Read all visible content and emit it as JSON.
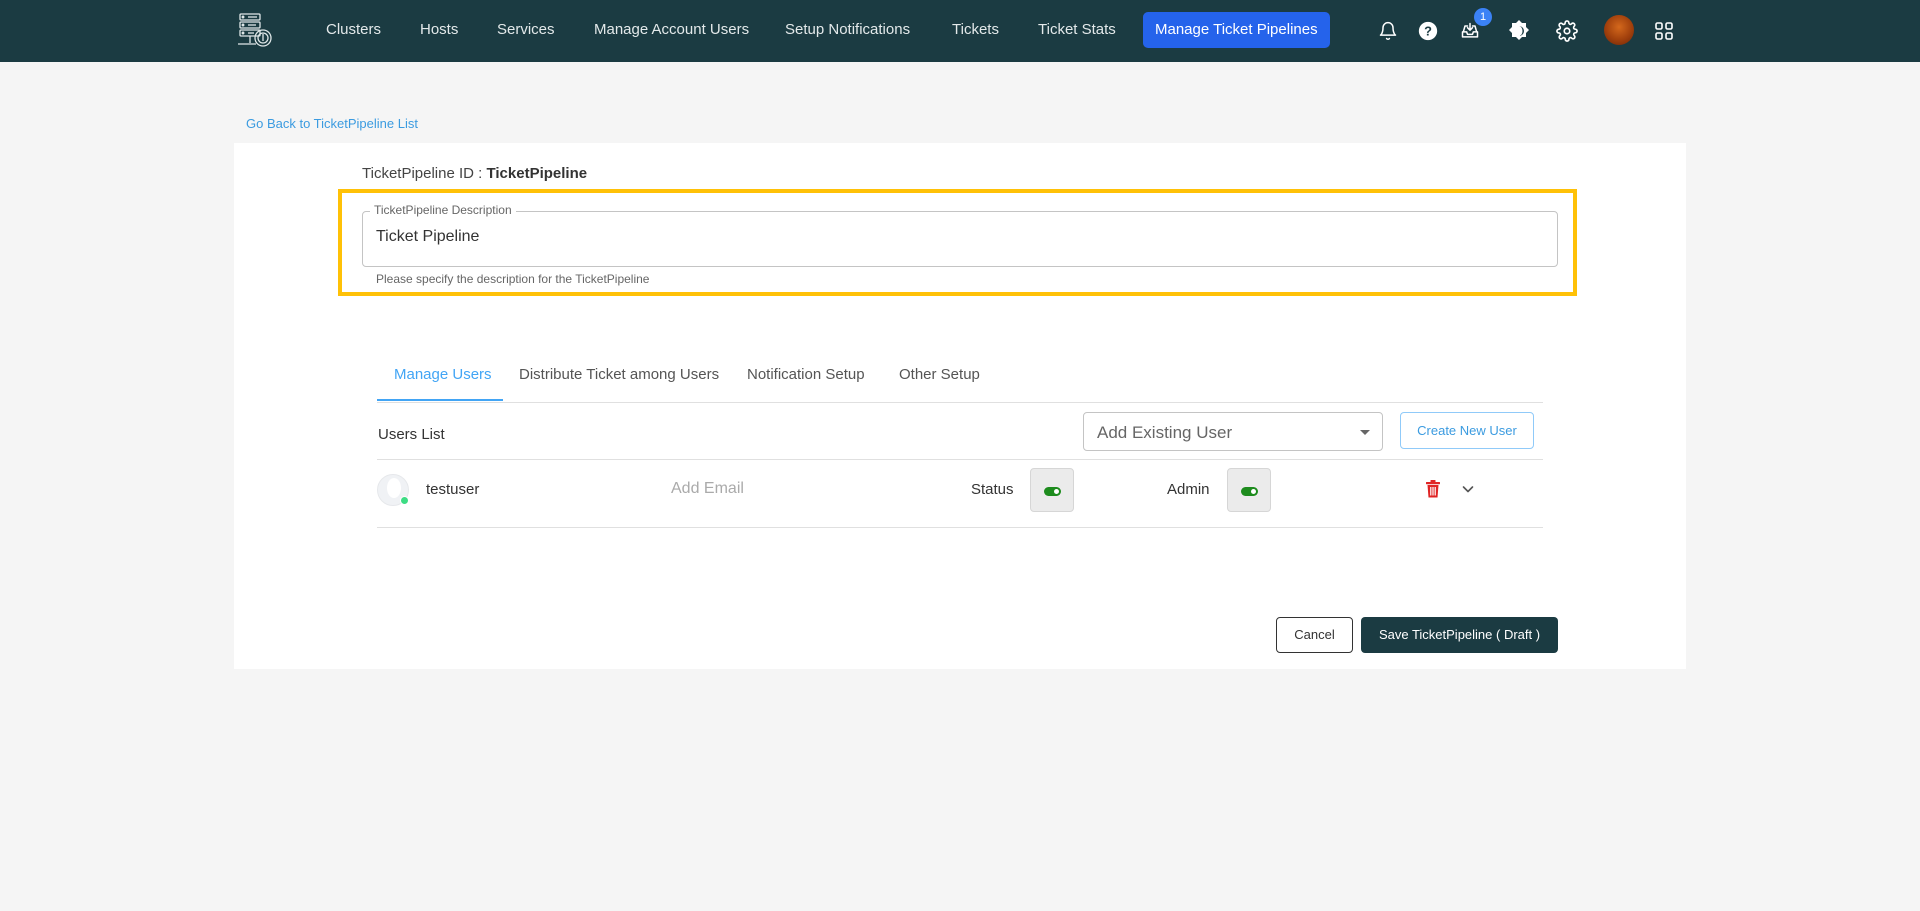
{
  "nav": {
    "items": [
      {
        "label": "Clusters"
      },
      {
        "label": "Hosts"
      },
      {
        "label": "Services"
      },
      {
        "label": "Manage Account Users"
      },
      {
        "label": "Setup Notifications"
      },
      {
        "label": "Tickets"
      },
      {
        "label": "Ticket Stats"
      },
      {
        "label": "Manage Ticket Pipelines",
        "active": true
      }
    ],
    "icons": [
      "bell-icon",
      "help-icon",
      "inbox-icon",
      "theme-icon",
      "gear-icon",
      "avatar",
      "apps-grid-icon"
    ],
    "inbox_badge": "1",
    "active_color": "#2563eb",
    "bg_color": "#1b3b42"
  },
  "back_link": "Go Back to TicketPipeline List",
  "pipeline": {
    "id_label": "TicketPipeline ID : ",
    "id_value": "TicketPipeline",
    "description_label": "TicketPipeline Description",
    "description_value": "Ticket Pipeline",
    "description_help": "Please specify the description for the TicketPipeline"
  },
  "tabs": [
    {
      "label": "Manage Users",
      "active": true
    },
    {
      "label": "Distribute Ticket among Users"
    },
    {
      "label": "Notification Setup"
    },
    {
      "label": "Other Setup"
    }
  ],
  "users": {
    "list_label": "Users List",
    "add_existing_placeholder": "Add Existing User",
    "create_new_label": "Create New User",
    "rows": [
      {
        "name": "testuser",
        "email_placeholder": "Add Email",
        "status_label": "Status",
        "status_on": true,
        "admin_label": "Admin",
        "admin_on": true,
        "online": true
      }
    ]
  },
  "actions": {
    "cancel": "Cancel",
    "save": "Save TicketPipeline ( Draft )"
  },
  "highlight_color": "#ffc107"
}
